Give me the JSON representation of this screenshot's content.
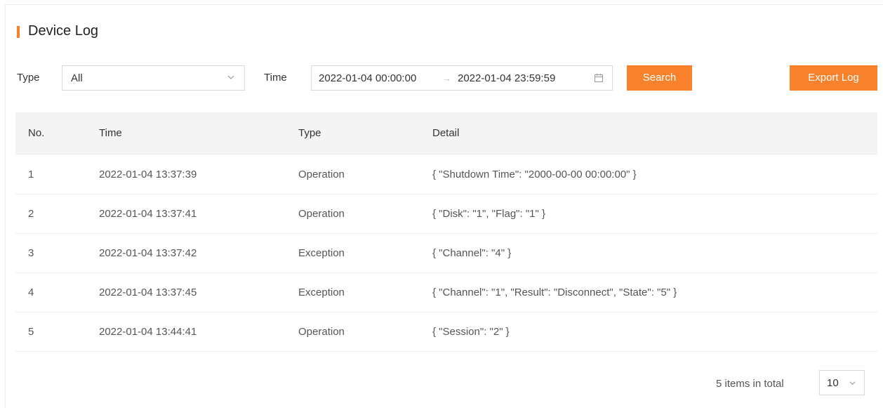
{
  "page": {
    "title": "Device Log"
  },
  "filters": {
    "type_label": "Type",
    "type_value": "All",
    "time_label": "Time",
    "time_start": "2022-01-04 00:00:00",
    "time_arrow": "→",
    "time_end": "2022-01-04 23:59:59",
    "search_label": "Search",
    "export_label": "Export Log"
  },
  "table": {
    "headers": {
      "no": "No.",
      "time": "Time",
      "type": "Type",
      "detail": "Detail"
    },
    "rows": [
      {
        "no": "1",
        "time": "2022-01-04 13:37:39",
        "type": "Operation",
        "detail": "{ \"Shutdown Time\": \"2000-00-00 00:00:00\" }"
      },
      {
        "no": "2",
        "time": "2022-01-04 13:37:41",
        "type": "Operation",
        "detail": "{ \"Disk\": \"1\", \"Flag\": \"1\" }"
      },
      {
        "no": "3",
        "time": "2022-01-04 13:37:42",
        "type": "Exception",
        "detail": "{ \"Channel\": \"4\" }"
      },
      {
        "no": "4",
        "time": "2022-01-04 13:37:45",
        "type": "Exception",
        "detail": "{ \"Channel\": \"1\", \"Result\": \"Disconnect\", \"State\": \"5\" }"
      },
      {
        "no": "5",
        "time": "2022-01-04 13:44:41",
        "type": "Operation",
        "detail": "{ \"Session\": \"2\" }"
      }
    ]
  },
  "pagination": {
    "total_text": "5 items in total",
    "page_size": "10"
  },
  "colors": {
    "accent": "#f7822b",
    "header_bg": "#f4f4f4",
    "border": "#d9d9d9"
  },
  "icons": {
    "type_dropdown": "chevron-down-icon",
    "date_picker": "calendar-icon",
    "page_size_dropdown": "chevron-down-icon"
  }
}
